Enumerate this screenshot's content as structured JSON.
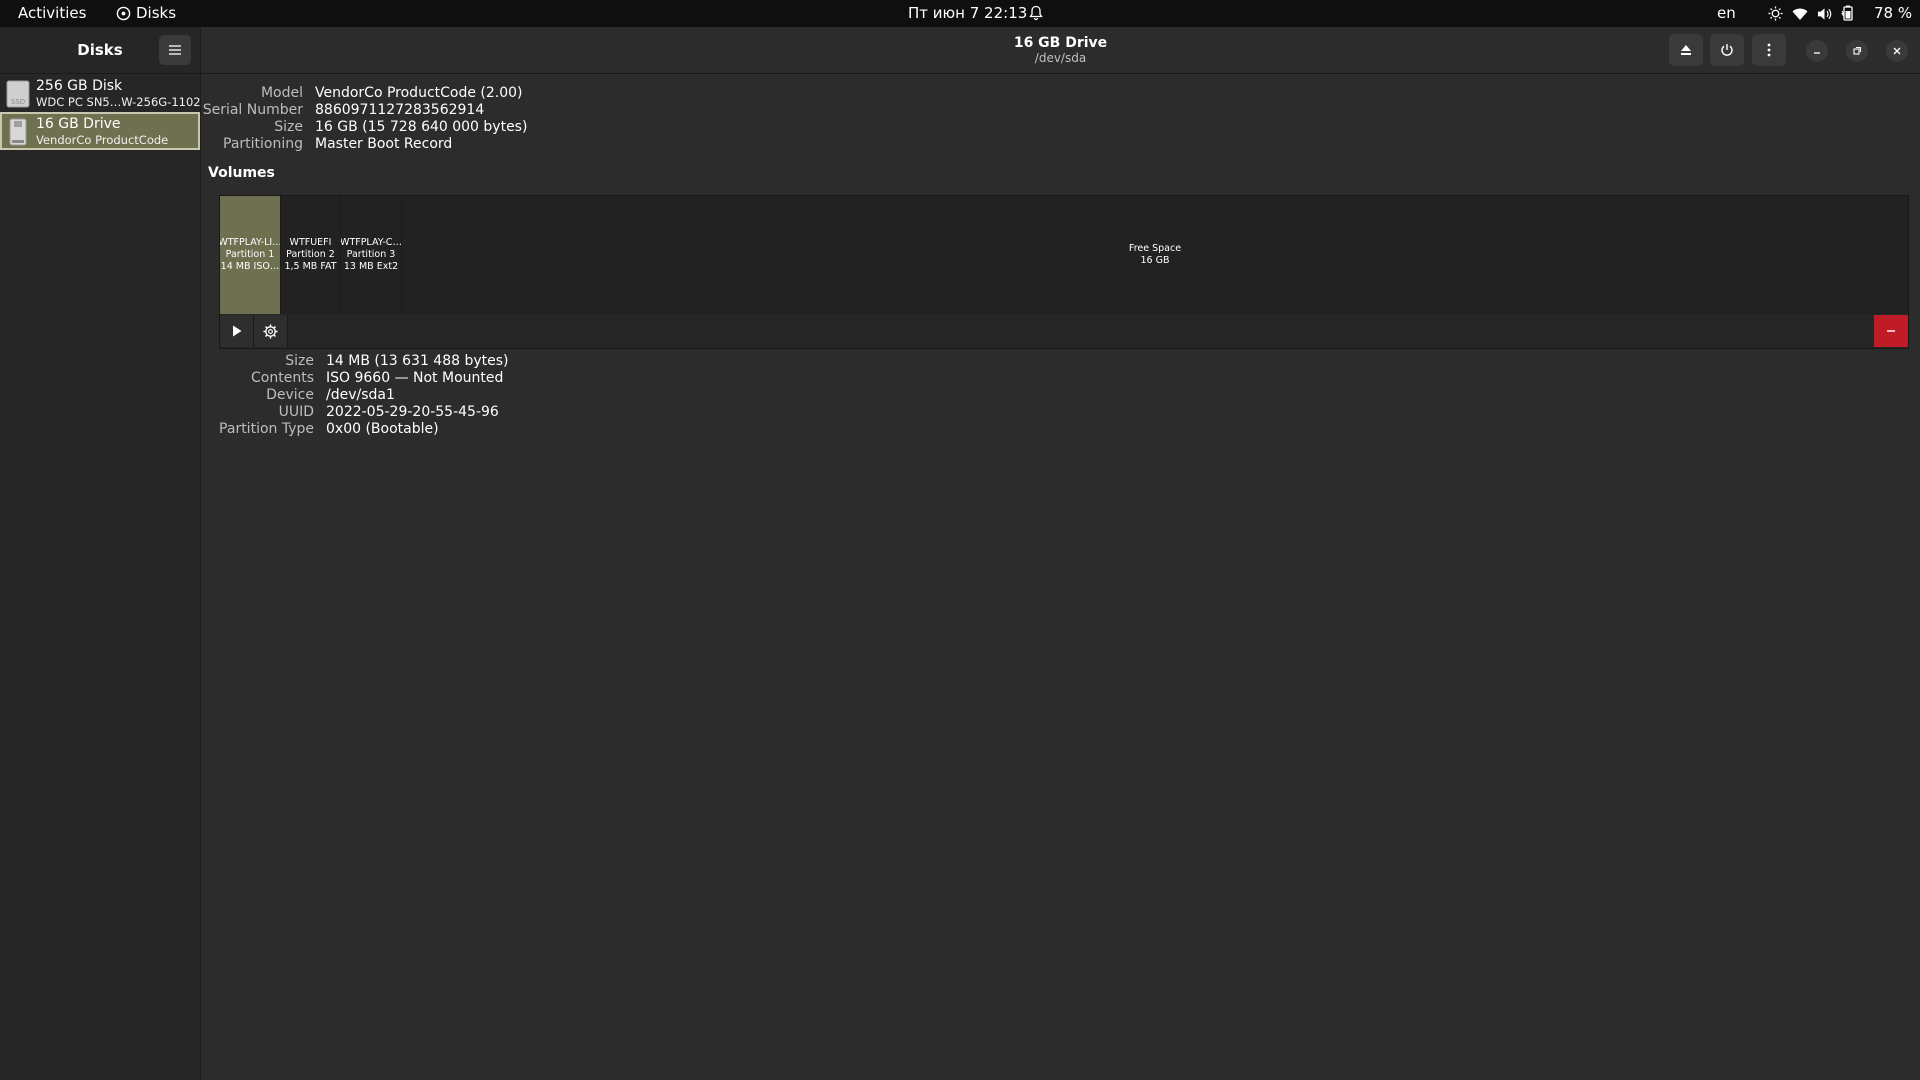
{
  "topbar": {
    "activities": "Activities",
    "app_name": "Disks",
    "clock": "Пт июн 7  22:13",
    "language": "en",
    "battery": "78 %"
  },
  "sidebar": {
    "title": "Disks",
    "items": [
      {
        "name": "256 GB Disk",
        "subtitle": "WDC PC SN5…W-256G-1102",
        "icon": "ssd-icon",
        "icon_text": "SSD",
        "selected": false
      },
      {
        "name": "16 GB Drive",
        "subtitle": "VendorCo ProductCode",
        "icon": "usb-drive-icon",
        "selected": true
      }
    ]
  },
  "header": {
    "title": "16 GB Drive",
    "subtitle": "/dev/sda"
  },
  "drive_info": {
    "labels": [
      "Model",
      "Serial Number",
      "Size",
      "Partitioning"
    ],
    "values": [
      "VendorCo ProductCode (2.00)",
      "8860971127283562914",
      "16 GB (15 728 640 000 bytes)",
      "Master Boot Record"
    ]
  },
  "volumes": {
    "title": "Volumes",
    "partitions": [
      {
        "line1": "WTFPLAY-LI…",
        "line2": "Partition 1",
        "line3": "14 MB ISO…",
        "selected": true
      },
      {
        "line1": "WTFUEFI",
        "line2": "Partition 2",
        "line3": "1,5 MB FAT",
        "selected": false
      },
      {
        "line1": "WTFPLAY-C…",
        "line2": "Partition 3",
        "line3": "13 MB Ext2",
        "selected": false
      },
      {
        "line1": "Free Space",
        "line2": "16 GB",
        "selected": false
      }
    ]
  },
  "partition_info": {
    "labels": [
      "Size",
      "Contents",
      "Device",
      "UUID",
      "Partition Type"
    ],
    "values": [
      "14 MB (13 631 488 bytes)",
      "ISO 9660 — Not Mounted",
      "/dev/sda1",
      "2022-05-29-20-55-45-96",
      "0x00 (Bootable)"
    ]
  },
  "colors": {
    "selection": "#6f7050",
    "delete": "#c01c28",
    "background": "#2c2c2c",
    "topbar": "#0f0f0f"
  }
}
